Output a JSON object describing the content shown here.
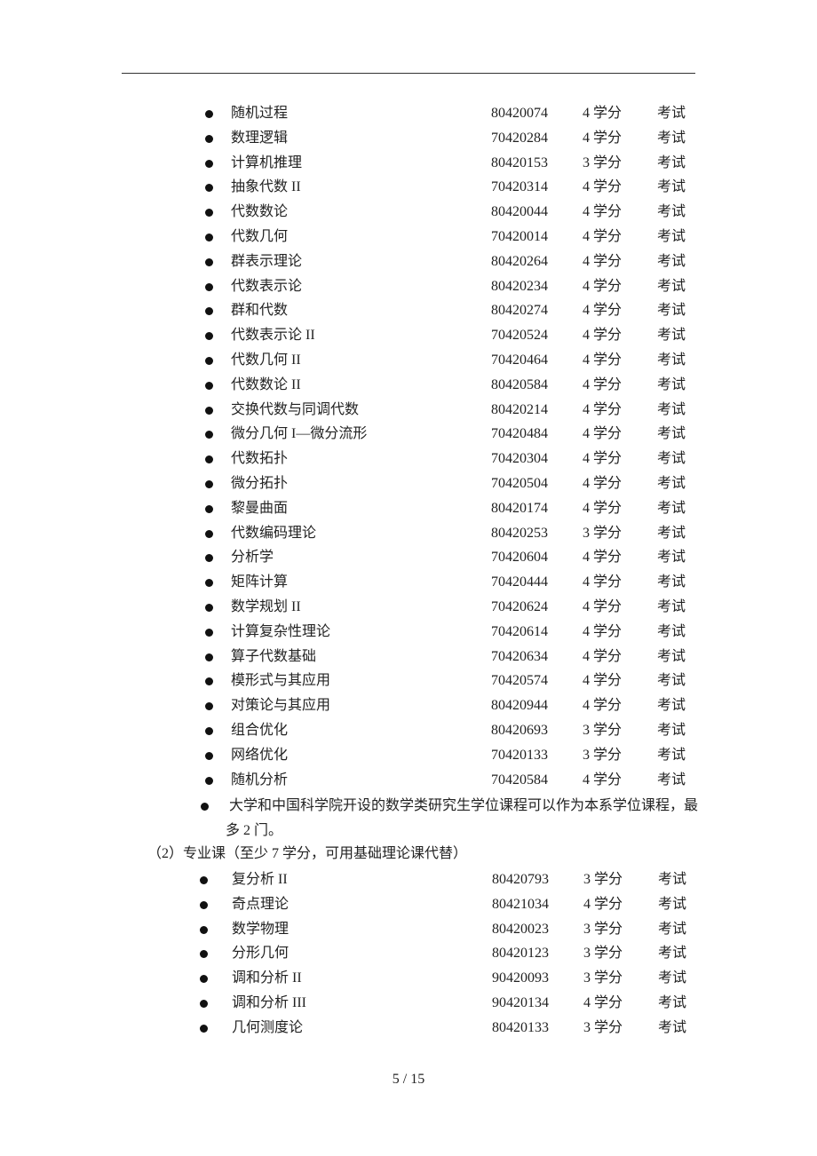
{
  "list1": [
    {
      "name": "随机过程",
      "code": "80420074",
      "credits": "4 学分",
      "assessment": "考试"
    },
    {
      "name": "数理逻辑",
      "code": "70420284",
      "credits": "4 学分",
      "assessment": "考试"
    },
    {
      "name": "计算机推理",
      "code": "80420153",
      "credits": "3 学分",
      "assessment": "考试"
    },
    {
      "name": "抽象代数 II",
      "code": "70420314",
      "credits": "4 学分",
      "assessment": "考试"
    },
    {
      "name": "代数数论",
      "code": "80420044",
      "credits": "4 学分",
      "assessment": "考试"
    },
    {
      "name": "代数几何",
      "code": "70420014",
      "credits": "4 学分",
      "assessment": "考试"
    },
    {
      "name": "群表示理论",
      "code": "80420264",
      "credits": "4 学分",
      "assessment": "考试"
    },
    {
      "name": "代数表示论",
      "code": "80420234",
      "credits": "4 学分",
      "assessment": "考试"
    },
    {
      "name": "群和代数",
      "code": "80420274",
      "credits": "4 学分",
      "assessment": "考试"
    },
    {
      "name": "代数表示论 II",
      "code": "70420524",
      "credits": "4 学分",
      "assessment": "考试"
    },
    {
      "name": "代数几何 II",
      "code": "70420464",
      "credits": "4 学分",
      "assessment": "考试"
    },
    {
      "name": "代数数论 II",
      "code": "80420584",
      "credits": "4 学分",
      "assessment": "考试"
    },
    {
      "name": "交换代数与同调代数",
      "code": "80420214",
      "credits": "4 学分",
      "assessment": "考试"
    },
    {
      "name": "微分几何 I—微分流形",
      "code": "70420484",
      "credits": "4 学分",
      "assessment": "考试"
    },
    {
      "name": "代数拓扑",
      "code": "70420304",
      "credits": "4 学分",
      "assessment": "考试"
    },
    {
      "name": "微分拓扑",
      "code": "70420504",
      "credits": "4 学分",
      "assessment": "考试"
    },
    {
      "name": "黎曼曲面",
      "code": "80420174",
      "credits": "4 学分",
      "assessment": "考试"
    },
    {
      "name": "代数编码理论",
      "code": "80420253",
      "credits": "3 学分",
      "assessment": "考试"
    },
    {
      "name": "分析学",
      "code": "70420604",
      "credits": "4 学分",
      "assessment": "考试"
    },
    {
      "name": "矩阵计算",
      "code": "70420444",
      "credits": "4 学分",
      "assessment": "考试"
    },
    {
      "name": "数学规划 II",
      "code": "70420624",
      "credits": "4 学分",
      "assessment": "考试"
    },
    {
      "name": "计算复杂性理论",
      "code": "70420614",
      "credits": "4 学分",
      "assessment": "考试"
    },
    {
      "name": "算子代数基础",
      "code": "70420634",
      "credits": "4 学分",
      "assessment": "考试"
    },
    {
      "name": "模形式与其应用",
      "code": "70420574",
      "credits": "4 学分",
      "assessment": "考试"
    },
    {
      "name": "对策论与其应用",
      "code": "80420944",
      "credits": "4 学分",
      "assessment": "考试"
    },
    {
      "name": "组合优化",
      "code": "80420693",
      "credits": "3 学分",
      "assessment": "考试"
    },
    {
      "name": "网络优化",
      "code": "70420133",
      "credits": "3 学分",
      "assessment": "考试"
    },
    {
      "name": "随机分析",
      "code": "70420584",
      "credits": "4 学分",
      "assessment": "考试"
    }
  ],
  "note": {
    "line1": "大学和中国科学院开设的数学类研究生学位课程可以作为本系学位课程，最",
    "line2": "多 2 门。"
  },
  "section2_heading": "（2）专业课（至少 7 学分，可用基础理论课代替）",
  "list2": [
    {
      "name": "复分析 II",
      "code": "80420793",
      "credits": "3 学分",
      "assessment": "考试"
    },
    {
      "name": "奇点理论",
      "code": "80421034",
      "credits": "4 学分",
      "assessment": "考试"
    },
    {
      "name": "数学物理",
      "code": "80420023",
      "credits": "3 学分",
      "assessment": "考试"
    },
    {
      "name": "分形几何",
      "code": "80420123",
      "credits": "3 学分",
      "assessment": "考试"
    },
    {
      "name": "调和分析 II",
      "code": "90420093",
      "credits": "3 学分",
      "assessment": "考试"
    },
    {
      "name": "调和分析 III",
      "code": "90420134",
      "credits": "4 学分",
      "assessment": "考试"
    },
    {
      "name": "几何测度论",
      "code": "80420133",
      "credits": "3 学分",
      "assessment": "考试"
    }
  ],
  "page_number": "5 / 15"
}
